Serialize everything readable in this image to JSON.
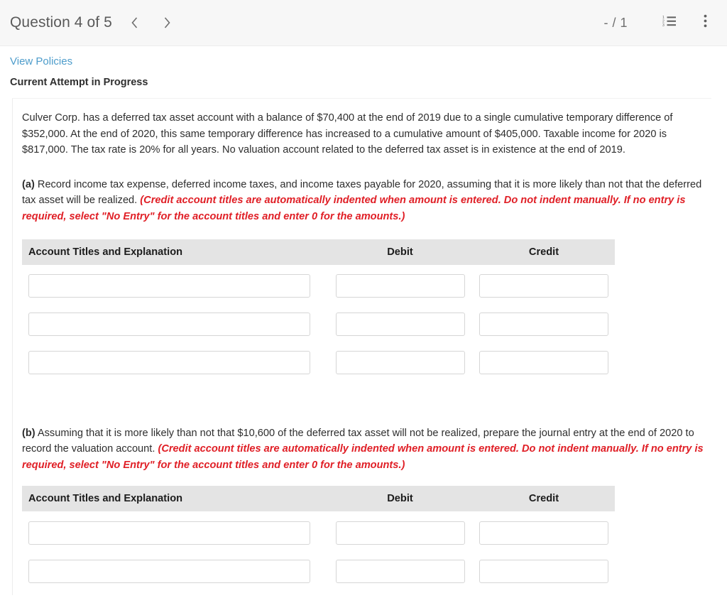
{
  "header": {
    "question_title": "Question 4 of 5",
    "prev_icon": "chevron-left-icon",
    "next_icon": "chevron-right-icon",
    "score": "- / 1",
    "list_icon": "numbered-list-icon",
    "menu_icon": "kebab-menu-icon"
  },
  "subheader": {
    "policies_link": "View Policies",
    "attempt_status": "Current Attempt in Progress"
  },
  "problem": {
    "statement": "Culver Corp. has a deferred tax asset account with a balance of $70,400 at the end of 2019 due to a single cumulative temporary difference of $352,000. At the end of 2020, this same temporary difference has increased to a cumulative amount of $405,000. Taxable income for 2020 is $817,000. The tax rate is 20% for all years. No valuation account related to the deferred tax asset is in existence at the end of 2019."
  },
  "parts": [
    {
      "label": "(a)",
      "prompt": " Record income tax expense, deferred income taxes, and income taxes payable for 2020, assuming that it is more likely than not that the deferred tax asset will be realized. ",
      "note": "(Credit account titles are automatically indented when amount is entered. Do not indent manually. If no entry is required, select \"No Entry\" for the account titles and enter 0 for the amounts.)",
      "table": {
        "columns": [
          "Account Titles and Explanation",
          "Debit",
          "Credit"
        ],
        "rows": [
          {
            "account": "",
            "debit": "",
            "credit": ""
          },
          {
            "account": "",
            "debit": "",
            "credit": ""
          },
          {
            "account": "",
            "debit": "",
            "credit": ""
          }
        ]
      }
    },
    {
      "label": "(b)",
      "prompt": " Assuming that it is more likely than not that $10,600 of the deferred tax asset will not be realized, prepare the journal entry at the end of 2020 to record the valuation account. ",
      "note": "(Credit account titles are automatically indented when amount is entered. Do not indent manually. If no entry is required, select \"No Entry\" for the account titles and enter 0 for the amounts.)",
      "table": {
        "columns": [
          "Account Titles and Explanation",
          "Debit",
          "Credit"
        ],
        "rows": [
          {
            "account": "",
            "debit": "",
            "credit": ""
          },
          {
            "account": "",
            "debit": "",
            "credit": ""
          }
        ]
      }
    }
  ],
  "colors": {
    "link": "#4d9ccb",
    "note_red": "#e01f26",
    "header_bg": "#f7f7f7",
    "table_header_bg": "#e4e4e4",
    "input_border": "#d6d6d6"
  }
}
